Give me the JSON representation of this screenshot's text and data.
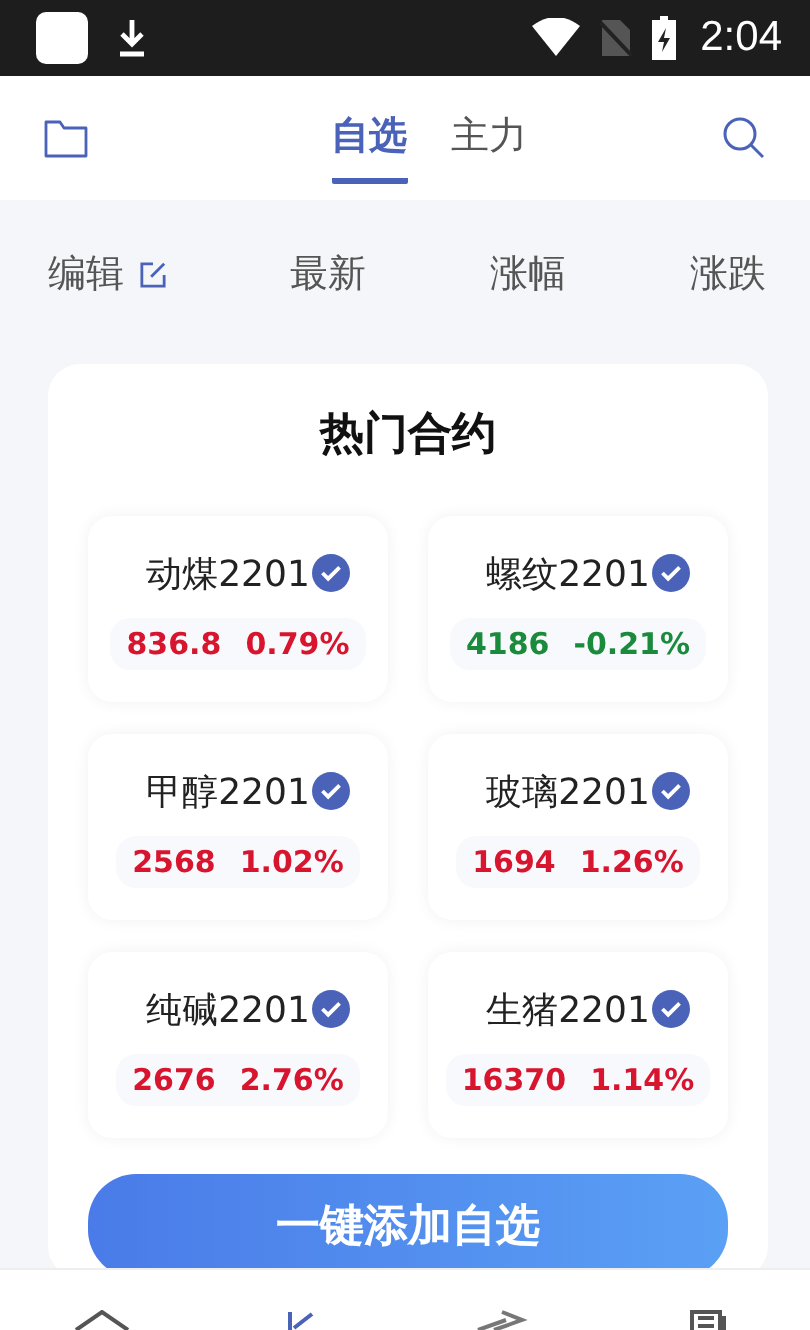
{
  "status_bar": {
    "time": "2:04"
  },
  "tabs": [
    {
      "label": "自选",
      "selected": true
    },
    {
      "label": "主力",
      "selected": false
    }
  ],
  "columns": {
    "edit": "编辑",
    "headers": [
      "最新",
      "涨幅",
      "涨跌"
    ]
  },
  "hot": {
    "title": "热门合约",
    "items": [
      {
        "name": "动煤2201",
        "price": "836.8",
        "change": "0.79%",
        "color": "#d8152e",
        "checked": true
      },
      {
        "name": "螺纹2201",
        "price": "4186",
        "change": "-0.21%",
        "color": "#1a8a3c",
        "checked": true
      },
      {
        "name": "甲醇2201",
        "price": "2568",
        "change": "1.02%",
        "color": "#d8152e",
        "checked": true
      },
      {
        "name": "玻璃2201",
        "price": "1694",
        "change": "1.26%",
        "color": "#d8152e",
        "checked": true
      },
      {
        "name": "纯碱2201",
        "price": "2676",
        "change": "2.76%",
        "color": "#d8152e",
        "checked": true
      },
      {
        "name": "生猪2201",
        "price": "16370",
        "change": "1.14%",
        "color": "#d8152e",
        "checked": true
      }
    ],
    "button": "一键添加自选"
  }
}
